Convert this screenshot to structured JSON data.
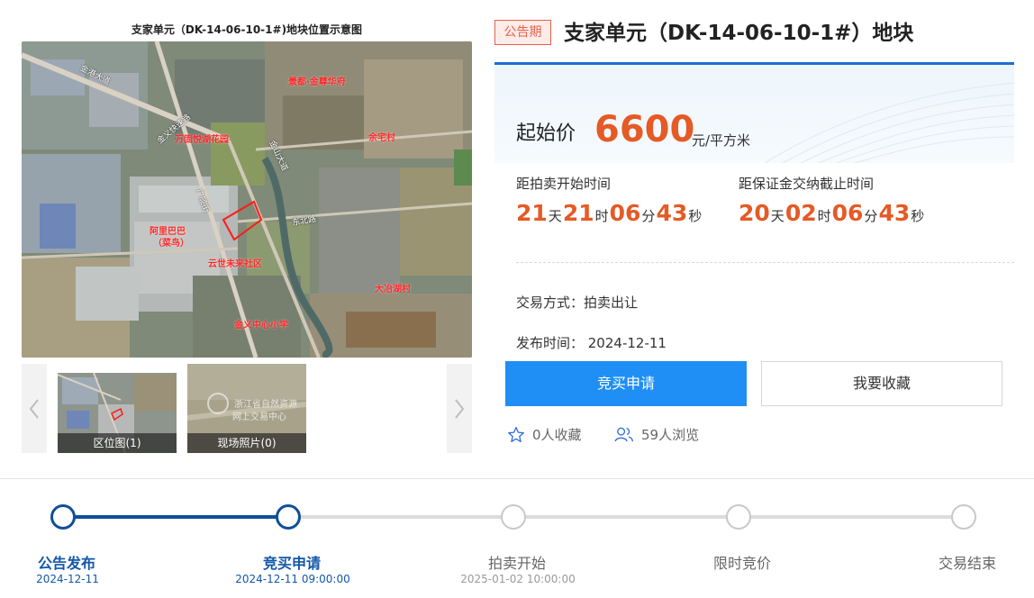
{
  "map": {
    "title": "支家单元（DK-14-06-10-1#)地块位置示意图",
    "labels": [
      "景都·金尊华府",
      "万固悦湖花园",
      "余宅村",
      "阿里巴巴",
      "（菜鸟）",
      "云世未来社区",
      "大冶湖村",
      "金义中心小学"
    ],
    "roads": [
      "金港大道",
      "金义快速路",
      "金山大道",
      "广顺街",
      "东北路"
    ]
  },
  "thumbnails": [
    {
      "caption": "区位图(1)"
    },
    {
      "caption": "现场照片(0)",
      "watermark_line1": "浙江省自然资源",
      "watermark_line2": "网上交易中心"
    }
  ],
  "header": {
    "status": "公告期",
    "title": "支家单元（DK-14-06-10-1#）地块"
  },
  "price": {
    "label": "起始价",
    "value": "6600",
    "unit": "元/平方米"
  },
  "countdowns": [
    {
      "label": "距拍卖开始时间",
      "days": "21",
      "hours": "21",
      "minutes": "06",
      "seconds": "43"
    },
    {
      "label": "距保证金交纳截止时间",
      "days": "20",
      "hours": "02",
      "minutes": "06",
      "seconds": "43"
    }
  ],
  "units": {
    "day": "天",
    "hour": "时",
    "minute": "分",
    "second": "秒"
  },
  "meta": {
    "trade_method": "交易方式：拍卖出让",
    "publish_time": "发布时间： 2024-12-11"
  },
  "actions": {
    "apply": "竞买申请",
    "favorite": "我要收藏"
  },
  "stats": {
    "favorites": "0人收藏",
    "views": "59人浏览"
  },
  "steps": [
    {
      "label": "公告发布",
      "date": "2024-12-11",
      "state": "done"
    },
    {
      "label": "竞买申请",
      "date": "2024-12-11 09:00:00",
      "state": "done"
    },
    {
      "label": "拍卖开始",
      "date": "2025-01-02 10:00:00",
      "state": "todo"
    },
    {
      "label": "限时竞价",
      "date": "",
      "state": "todo"
    },
    {
      "label": "交易结束",
      "date": "",
      "state": "todo"
    }
  ],
  "colors": {
    "accent_blue": "#1f8ff5",
    "progress_blue": "#0f4f9a",
    "price_orange": "#e55a25",
    "badge_red": "#e8604c"
  }
}
